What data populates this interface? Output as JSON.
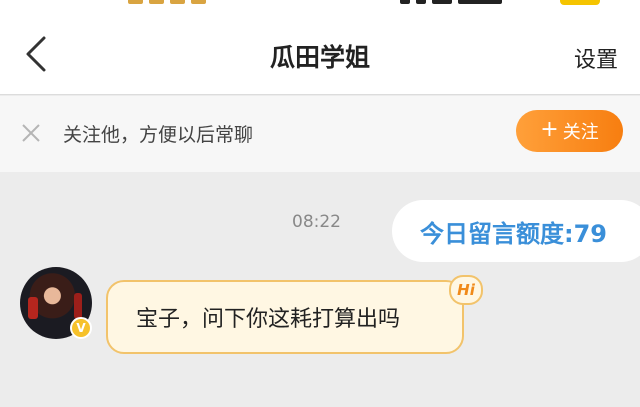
{
  "header": {
    "title": "瓜田学姐",
    "settings_label": "设置",
    "back_icon": "chevron-left-icon"
  },
  "follow_banner": {
    "text": "关注他，方便以后常聊",
    "button_plus": "+",
    "button_label": "关注",
    "close_icon": "close-icon",
    "button_color": "#f77e10"
  },
  "chat": {
    "timestamp": "08:22",
    "quota_label": "今日留言额度:79",
    "message": "宝子，问下你这耗打算出吗",
    "hi_badge": "Hi",
    "verified_badge": "V",
    "accent_color": "#3a8fd9",
    "bubble_border_color": "#f2c36b"
  }
}
